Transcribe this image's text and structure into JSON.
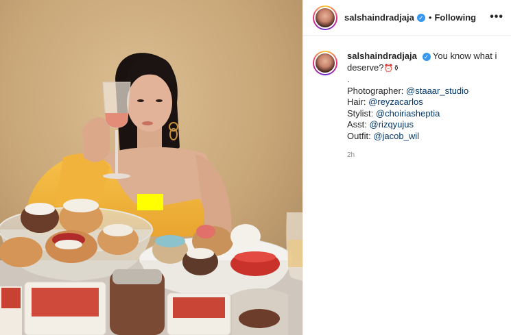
{
  "post": {
    "username": "salshaindradjaja",
    "separator": "•",
    "follow_status": "Following",
    "more_label": "•••"
  },
  "caption": {
    "username": "salshaindradjaja",
    "text": "You know what i deserve?",
    "emojis": [
      "⏰",
      "⚱"
    ],
    "dot_line": ".",
    "credits": [
      {
        "label": "Photographer:",
        "handle": "@staaar_studio"
      },
      {
        "label": "Hair:",
        "handle": "@reyzacarlos"
      },
      {
        "label": "Stylist:",
        "handle": "@choiriasheptia"
      },
      {
        "label": "Asst:",
        "handle": "@rizqyujus"
      },
      {
        "label": "Outfit:",
        "handle": "@jacob_wil"
      }
    ],
    "time_ago": "2h"
  },
  "colors": {
    "mention": "#00376b",
    "verified": "#3897f0",
    "censor": "#ffff00",
    "dress": "#f2b33d"
  }
}
